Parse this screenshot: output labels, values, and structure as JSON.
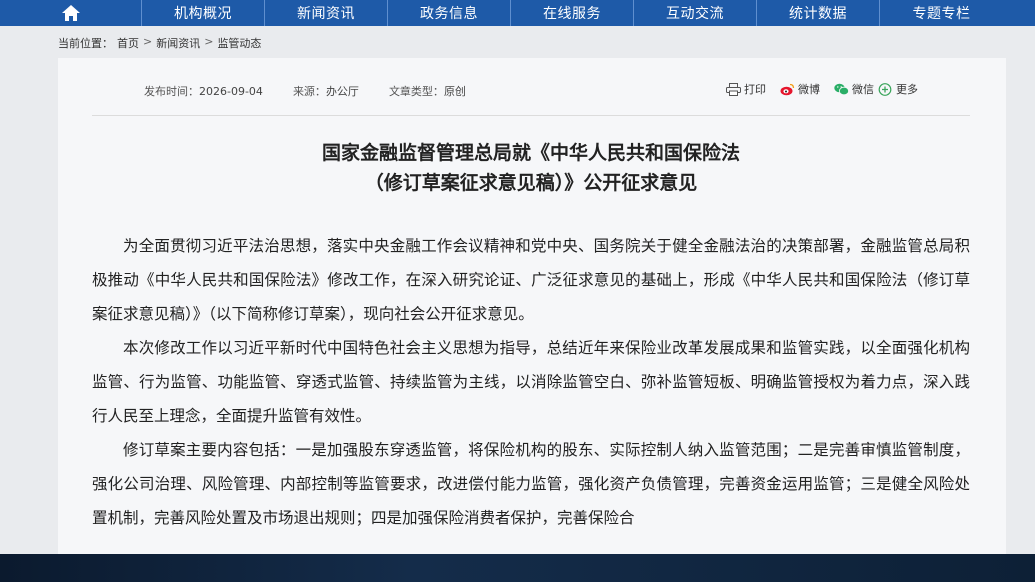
{
  "nav": {
    "items": [
      "机构概况",
      "新闻资讯",
      "政务信息",
      "在线服务",
      "互动交流",
      "统计数据",
      "专题专栏"
    ]
  },
  "breadcrumb": {
    "prefix": "当前位置：",
    "items": [
      "首页",
      "新闻资讯",
      "监管动态"
    ],
    "separator": ">"
  },
  "meta": {
    "date_label": "发布时间：",
    "date": "2026-09-04",
    "source_label": "来源：",
    "source": "办公厅",
    "type_label": "文章类型：",
    "type": "原创"
  },
  "share": {
    "print": "打印",
    "weibo": "微博",
    "wechat": "微信",
    "more": "更多"
  },
  "article": {
    "title_line1": "国家金融监督管理总局就《中华人民共和国保险法",
    "title_line2": "（修订草案征求意见稿）》公开征求意见",
    "paragraphs": [
      "为全面贯彻习近平法治思想，落实中央金融工作会议精神和党中央、国务院关于健全金融法治的决策部署，金融监管总局积极推动《中华人民共和国保险法》修改工作，在深入研究论证、广泛征求意见的基础上，形成《中华人民共和国保险法（修订草案征求意见稿）》（以下简称修订草案），现向社会公开征求意见。",
      "本次修改工作以习近平新时代中国特色社会主义思想为指导，总结近年来保险业改革发展成果和监管实践，以全面强化机构监管、行为监管、功能监管、穿透式监管、持续监管为主线，以消除监管空白、弥补监管短板、明确监管授权为着力点，深入践行人民至上理念，全面提升监管有效性。",
      "修订草案主要内容包括：一是加强股东穿透监管，将保险机构的股东、实际控制人纳入监管范围；二是完善审慎监管制度，强化公司治理、风险管理、内部控制等监管要求，改进偿付能力监管，强化资产负债管理，完善资金运用监管；三是健全风险处置机制，完善风险处置及市场退出规则；四是加强保险消费者保护，完善保险合"
    ]
  },
  "colors": {
    "nav_bg": "#1e5aa8",
    "page_bg": "#e9ebee",
    "panel_bg": "#f6f7f9"
  }
}
